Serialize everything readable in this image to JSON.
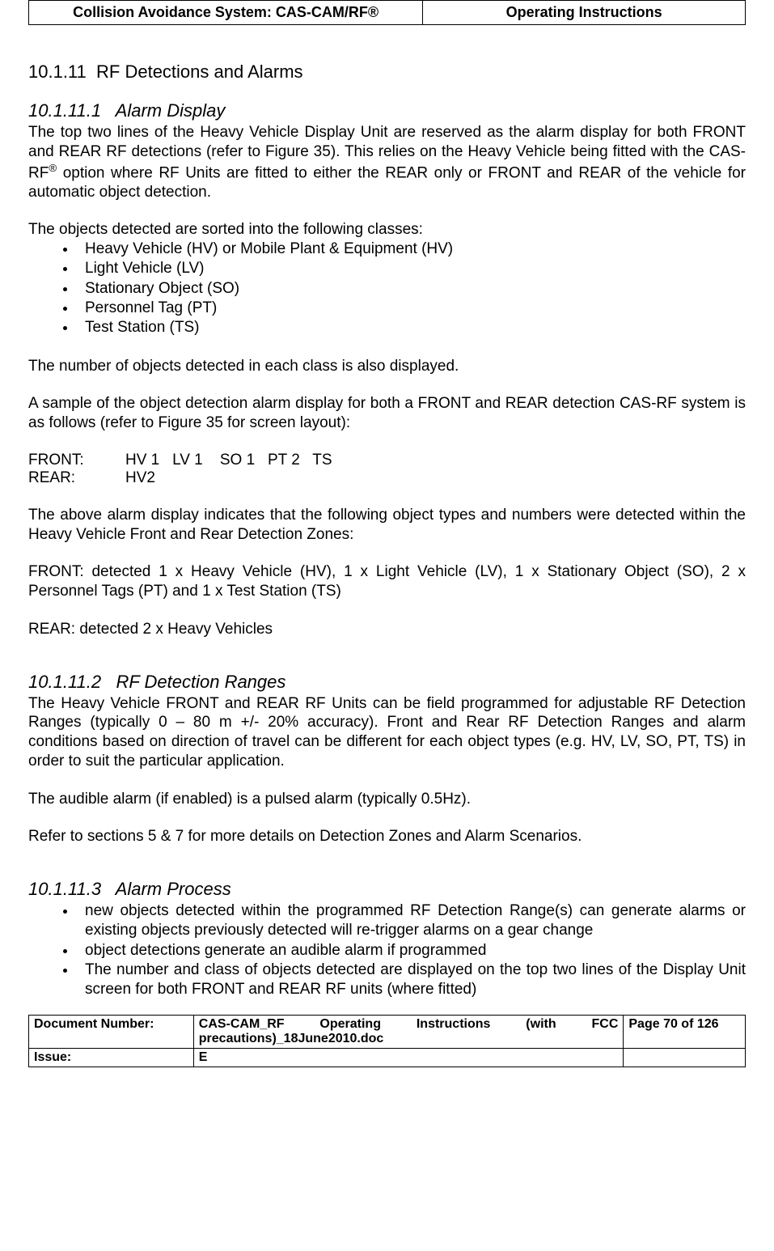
{
  "header": {
    "left": "Collision Avoidance System: CAS-CAM/RF®",
    "right": "Operating Instructions"
  },
  "section": {
    "number": "10.1.11",
    "title": "RF Detections and Alarms"
  },
  "sub1": {
    "number": "10.1.11.1",
    "title": "Alarm Display",
    "para1a": "The top two lines of the Heavy Vehicle Display Unit are reserved as the alarm display for both FRONT and REAR RF detections (refer to Figure 35). This relies on the Heavy Vehicle being fitted with the CAS-RF",
    "para1b": " option where RF Units are fitted to either the REAR only or FRONT and REAR of the vehicle for automatic object detection.",
    "para2": "The objects detected are sorted into the following classes:",
    "bullets": [
      "Heavy Vehicle (HV) or Mobile Plant & Equipment (HV)",
      "Light Vehicle (LV)",
      "Stationary Object (SO)",
      "Personnel Tag (PT)",
      "Test Station (TS)"
    ],
    "para3": "The number of objects detected in each class is also displayed.",
    "para4": "A sample of the object detection alarm display for both a FRONT and REAR detection CAS-RF system is as follows (refer to Figure 35 for screen layout):",
    "sample_front_label": "FRONT:",
    "sample_front_value": "HV 1   LV 1    SO 1   PT 2   TS",
    "sample_rear_label": "REAR:",
    "sample_rear_value": "HV2",
    "para5": "The above alarm display indicates that the following object types and numbers were detected within the Heavy Vehicle Front and Rear Detection Zones:",
    "para6": "FRONT:  detected 1 x Heavy Vehicle (HV), 1 x Light Vehicle (LV), 1 x Stationary Object (SO), 2 x Personnel Tags (PT) and 1 x Test Station (TS)",
    "para7": "REAR:  detected 2 x Heavy Vehicles"
  },
  "sub2": {
    "number": "10.1.11.2",
    "title": "RF Detection Ranges",
    "para1": "The Heavy Vehicle FRONT and REAR RF Units can be field programmed for adjustable RF Detection Ranges (typically 0 – 80 m +/- 20% accuracy). Front and Rear RF Detection Ranges and alarm conditions based on direction of travel can be different for each object types (e.g. HV, LV, SO, PT, TS) in order to suit the particular application.",
    "para2": "The audible alarm (if enabled) is a pulsed alarm (typically 0.5Hz).",
    "para3": "Refer to sections 5 & 7 for more details on Detection Zones and Alarm Scenarios."
  },
  "sub3": {
    "number": "10.1.11.3",
    "title": "Alarm Process",
    "bullets": [
      "new objects detected within the programmed RF Detection Range(s) can generate alarms or existing objects previously detected will re-trigger alarms on a gear change",
      "object detections generate an audible alarm if programmed",
      "The number and class of objects detected are displayed on the top two lines of the Display Unit screen for both FRONT and REAR RF units (where fitted)"
    ]
  },
  "footer": {
    "doc_num_label": "Document Number:",
    "doc_num_value": "CAS-CAM_RF Operating Instructions (with FCC precautions)_18June2010.doc",
    "page_label": "Page 70 of  126",
    "issue_label": "Issue:",
    "issue_value": "E"
  },
  "registered": "®"
}
